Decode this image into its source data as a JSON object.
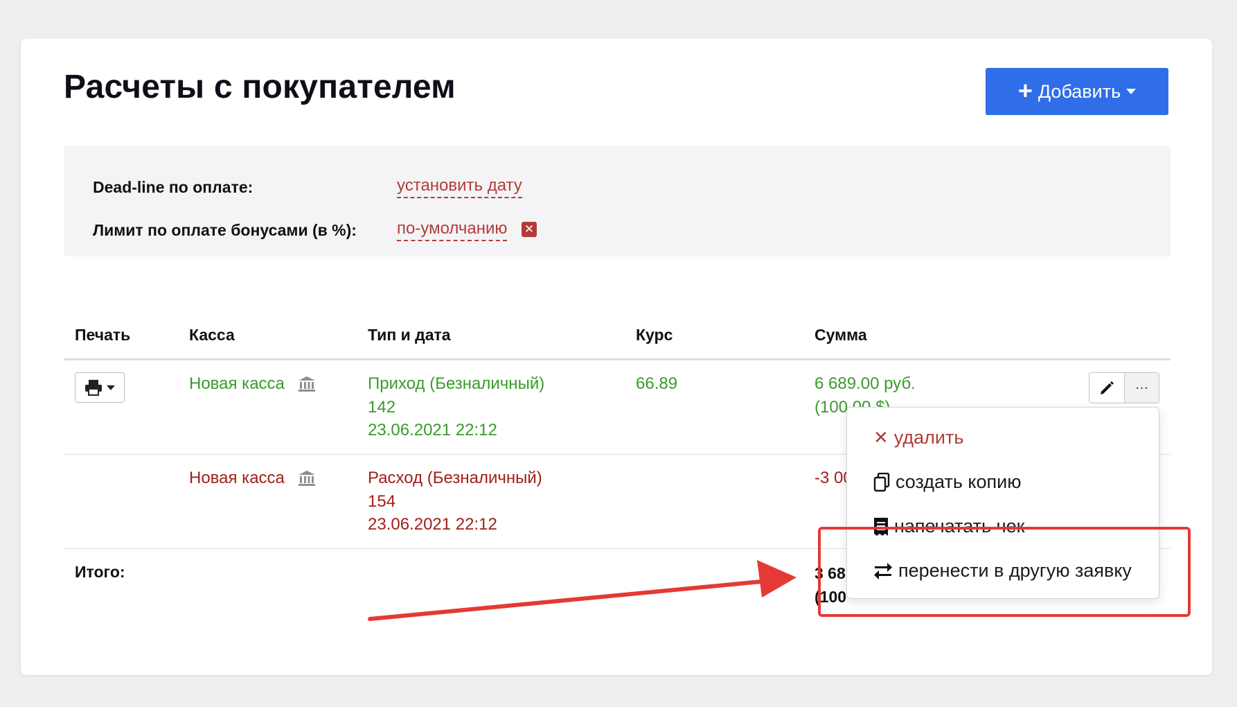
{
  "page": {
    "title": "Расчеты с покупателем",
    "add_button": {
      "label": "Добавить"
    }
  },
  "settings": {
    "deadline": {
      "label": "Dead-line по оплате:",
      "value": "установить дату"
    },
    "bonus_limit": {
      "label": "Лимит по оплате бонусами (в %):",
      "value": "по-умолчанию"
    }
  },
  "table": {
    "headers": [
      "Печать",
      "Касса",
      "Тип и дата",
      "Курс",
      "Сумма"
    ],
    "rows": [
      {
        "kassa": "Новая касса",
        "type": "Приход (Безналичный)",
        "number": "142",
        "date": "23.06.2021 22:12",
        "rate": "66.89",
        "amount": "6 689.00 руб.",
        "amount_secondary": "(100.00 $)",
        "status_color": "#3a9a2c"
      },
      {
        "kassa": "Новая касса",
        "type": "Расход (Безналичный)",
        "number": "154",
        "date": "23.06.2021 22:12",
        "rate": "",
        "amount": "-3 00",
        "status_color": "#a11f1a"
      }
    ],
    "total": {
      "label": "Итого:",
      "value": "3 68",
      "value_secondary": "(100"
    }
  },
  "dropdown_menu": {
    "items": [
      {
        "label": "удалить",
        "icon": "close-icon"
      },
      {
        "label": "создать копию",
        "icon": "copy-icon"
      },
      {
        "label": "напечатать чек",
        "icon": "receipt-icon"
      },
      {
        "label": "перенести в другую заявку",
        "icon": "transfer-icon"
      }
    ]
  },
  "colors": {
    "accent": "#2f6ee8",
    "link": "#b33b36",
    "income": "#3a9a2c",
    "expense": "#a11f1a",
    "annotation": "#e53935"
  }
}
